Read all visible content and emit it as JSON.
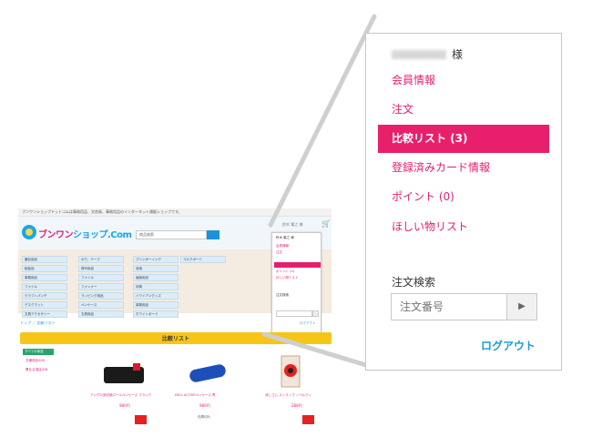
{
  "thumbnail": {
    "top_text": "ブンワンショップドットコムは事務用品、文房具、事務用品のインターネット通販ショップです。",
    "logo_text_a": "ブンワン",
    "logo_text_b": "ショップ.Com",
    "search_placeholder": "商品検索",
    "user_text": "鈴木 葉之 様",
    "cart_icon": "cart-icon",
    "categories": [
      "筆記用品",
      "紙製品",
      "事務用品",
      "ファイル",
      "クラフトパンチ",
      "デスクマット",
      "文具アクセサリー",
      "のり、テープ",
      "荷印用品",
      "ファイル",
      "ファンナー",
      "ラッピング用品",
      "ペンケース",
      "文具用品",
      "プリンターインク",
      "収納",
      "画版用品",
      "封筒",
      "ハワイアングッズ",
      "事務用品",
      "ホワイトボード",
      "コルクボード"
    ],
    "dropdown_items": [
      "鈴木 葉之 様",
      "会員情報",
      "注文",
      "比較リスト (3)",
      "登録済みカード情報",
      "ポイント (0)",
      "ほしい物リスト",
      "注文検索",
      "注文番号",
      "ログアウト"
    ],
    "breadcrumb": "トップ ／ 比較リスト",
    "compare_title": "比較リスト",
    "all_categories_tag": "すべての商品",
    "side_links": [
      "共通項目のみ",
      "異なる項目のみ"
    ],
    "products": [
      {
        "name": "アングロ多収納ロールペンケース ブラック",
        "price": "980円",
        "stock": ""
      },
      {
        "name": "DELL ACTIVEペンケース 青",
        "price": "980円",
        "stock": "在庫切れ"
      },
      {
        "name": "消しゴム ストラップ ノベルティ",
        "price": "288円",
        "stock": ""
      }
    ]
  },
  "panel": {
    "user_suffix": "様",
    "menu": [
      {
        "label": "会員情報"
      },
      {
        "label": "注文"
      },
      {
        "label": "比較リスト (3)"
      },
      {
        "label": "登録済みカード情報"
      },
      {
        "label": "ポイント (0)"
      },
      {
        "label": "ほしい物リスト"
      }
    ],
    "order_search_label": "注文検索",
    "order_number_placeholder": "注文番号",
    "search_button_icon": "play-arrow-icon",
    "search_button_glyph": "▶",
    "logout_label": "ログアウト"
  },
  "colors": {
    "accent_pink": "#e8206c",
    "link_blue": "#1c9ad8",
    "title_bar_yellow": "#f7c518"
  }
}
